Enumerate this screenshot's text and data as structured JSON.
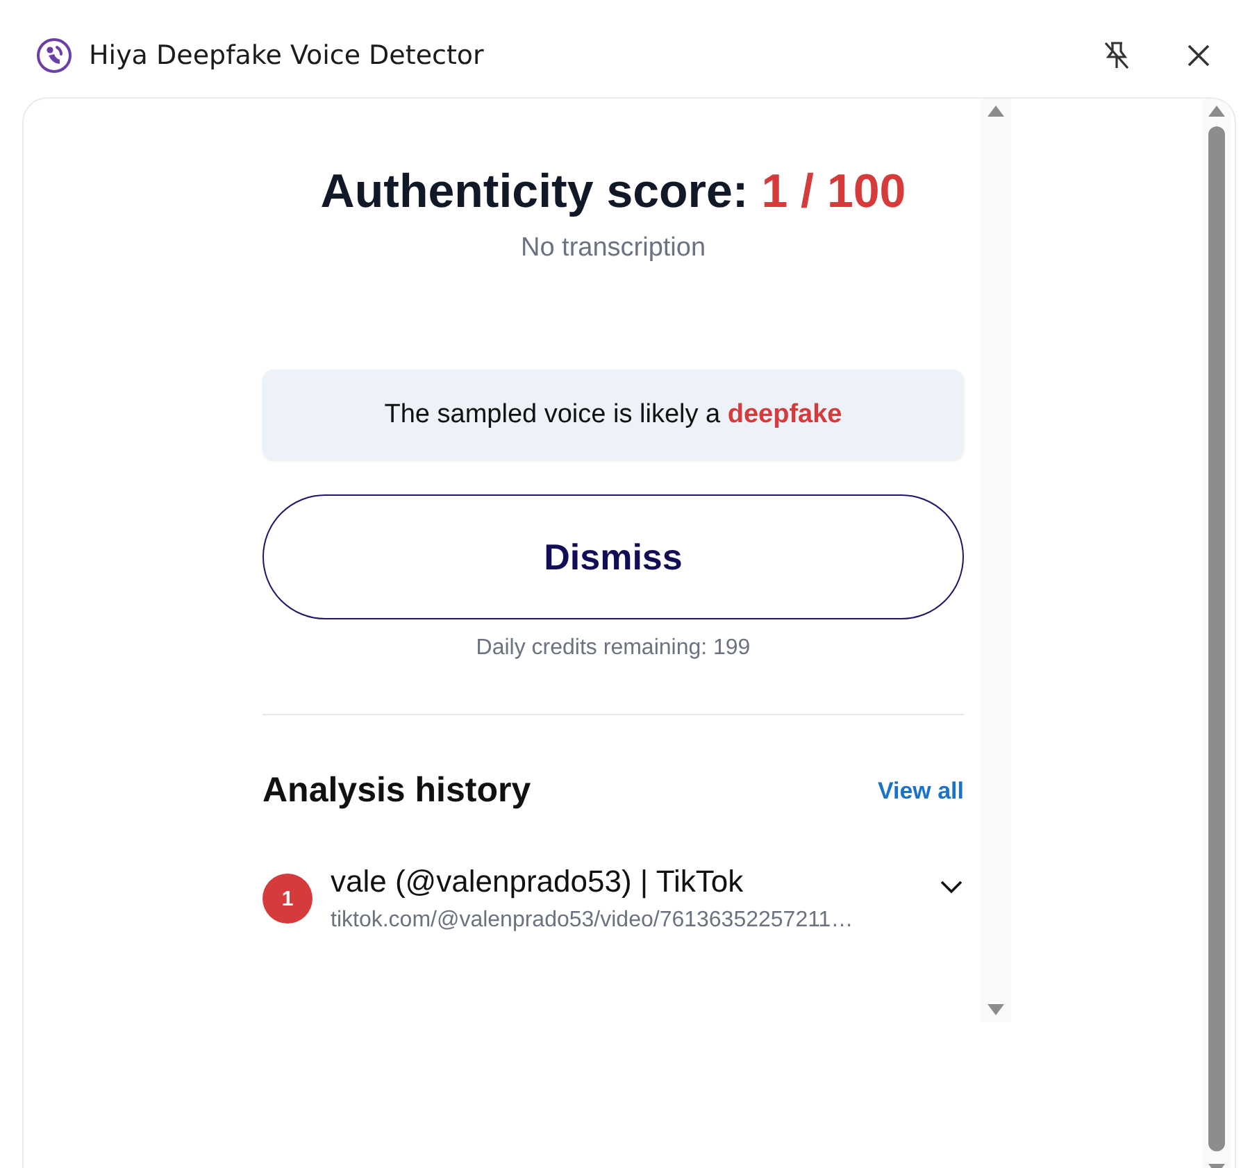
{
  "window": {
    "title": "Hiya Deepfake Voice Detector"
  },
  "score": {
    "label": "Authenticity score:",
    "value": "1 / 100"
  },
  "transcription": "No transcription",
  "verdict": {
    "text": "The sampled voice is likely a",
    "emphasis": "deepfake"
  },
  "dismiss_button": "Dismiss",
  "credits": "Daily credits remaining: 199",
  "history": {
    "title": "Analysis history",
    "view_all": "View all",
    "items": [
      {
        "badge": "1",
        "title": "vale (@valenprado53) | TikTok",
        "url": "tiktok.com/@valenprado53/video/76136352257211…",
        "expanded": false
      }
    ]
  }
}
